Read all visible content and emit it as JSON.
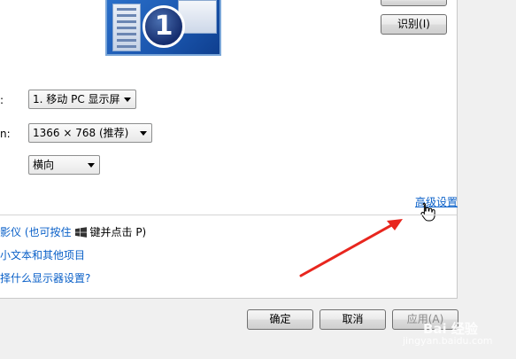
{
  "buttons": {
    "top_hidden": "",
    "identify": "识别(I)",
    "ok": "确定",
    "cancel": "取消",
    "apply": "应用(A)"
  },
  "monitor_number": "1",
  "settings": {
    "display_label": ":",
    "display_value": "1. 移动 PC 显示屏",
    "resolution_label": "n:",
    "resolution_value": "1366 × 768 (推荐)",
    "orientation_value": "横向"
  },
  "links": {
    "advanced": "高级设置",
    "projector_prefix": "影仪 (也可按住",
    "projector_suffix": "键并点击 P)",
    "text_size": "小文本和其他项目",
    "which_settings": "择什么显示器设置?"
  },
  "watermark": {
    "brand": "Bai 经验",
    "url": "jingyan.baidu.com"
  },
  "colors": {
    "link": "#0a60c8",
    "arrow": "#e8261e",
    "panel": "#ffffff",
    "background": "#f0f0f0"
  }
}
